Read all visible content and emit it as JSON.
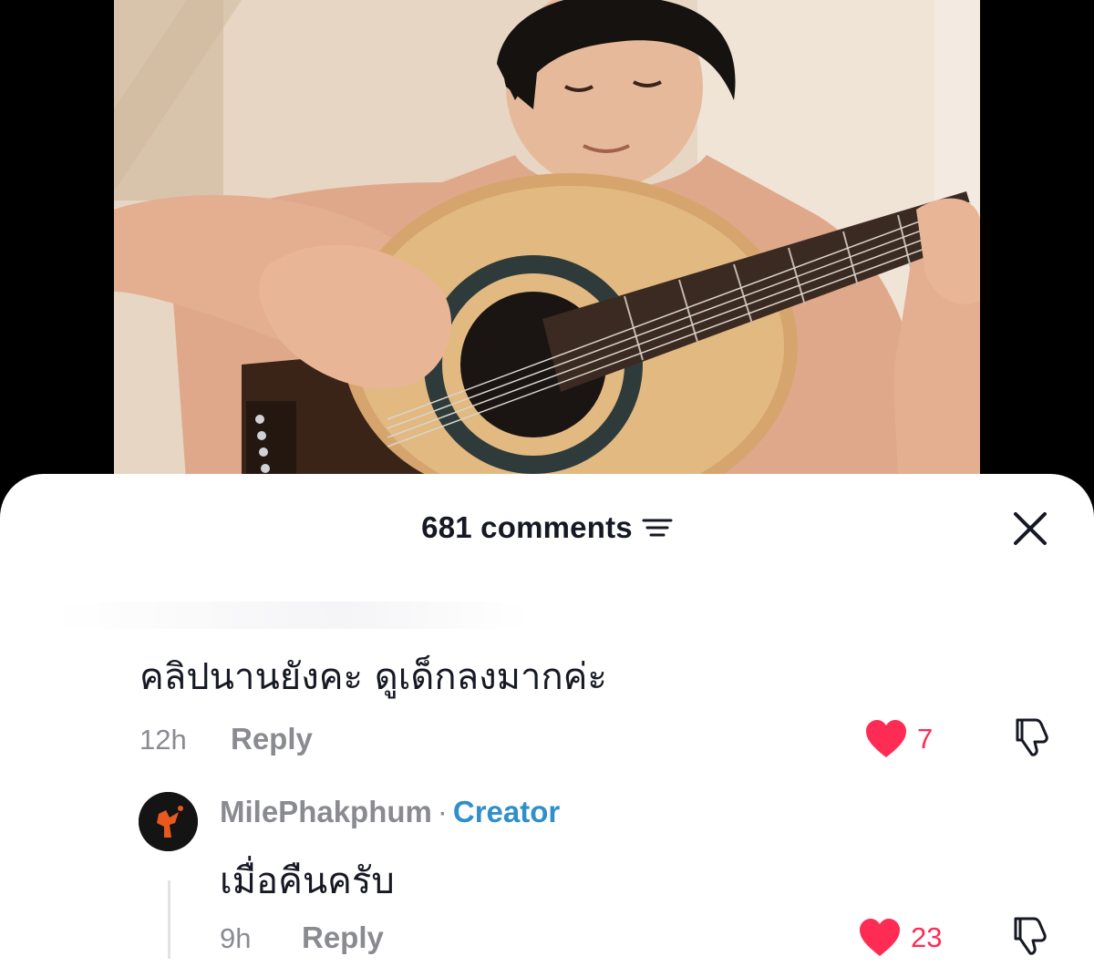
{
  "video": {
    "description_icon": "video-frame"
  },
  "comments": {
    "count_label": "681 comments",
    "sort_icon": "sort-icon",
    "close_icon": "close-icon"
  },
  "comment": {
    "text": "คลิปนานยังคะ ดูเด็กลงมากค่ะ",
    "time": "12h",
    "reply_label": "Reply",
    "likes": "7"
  },
  "reply": {
    "author": "MilePhakphum",
    "separator": "·",
    "badge": "Creator",
    "text": "เมื่อคืนครับ",
    "time": "9h",
    "reply_label": "Reply",
    "likes": "23"
  },
  "colors": {
    "like": "#fe2c55",
    "creator_badge": "#2f8fc9",
    "muted_text": "#8a8b91",
    "primary_text": "#161823"
  }
}
